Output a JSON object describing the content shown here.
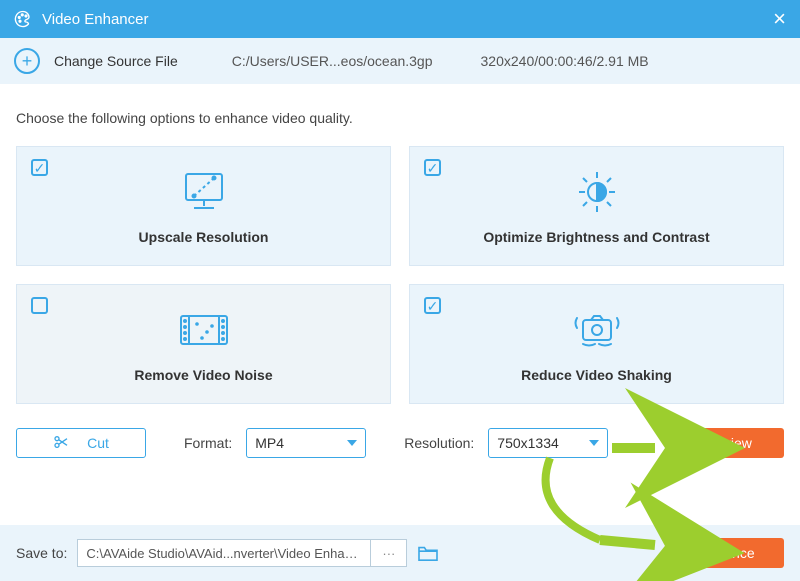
{
  "titlebar": {
    "title": "Video Enhancer"
  },
  "sourcebar": {
    "change_label": "Change Source File",
    "path": "C:/Users/USER...eos/ocean.3gp",
    "meta": "320x240/00:00:46/2.91 MB"
  },
  "main": {
    "instruction": "Choose the following options to enhance video quality."
  },
  "cards": {
    "upscale": {
      "label": "Upscale Resolution",
      "checked": true
    },
    "brightness": {
      "label": "Optimize Brightness and Contrast",
      "checked": true
    },
    "noise": {
      "label": "Remove Video Noise",
      "checked": false
    },
    "shaking": {
      "label": "Reduce Video Shaking",
      "checked": true
    }
  },
  "controls": {
    "cut_label": "Cut",
    "format_label": "Format:",
    "format_value": "MP4",
    "resolution_label": "Resolution:",
    "resolution_value": "750x1334",
    "preview_label": "Preview"
  },
  "footer": {
    "save_label": "Save to:",
    "path": "C:\\AVAide Studio\\AVAid...nverter\\Video Enhancer",
    "enhance_label": "Enhance"
  }
}
